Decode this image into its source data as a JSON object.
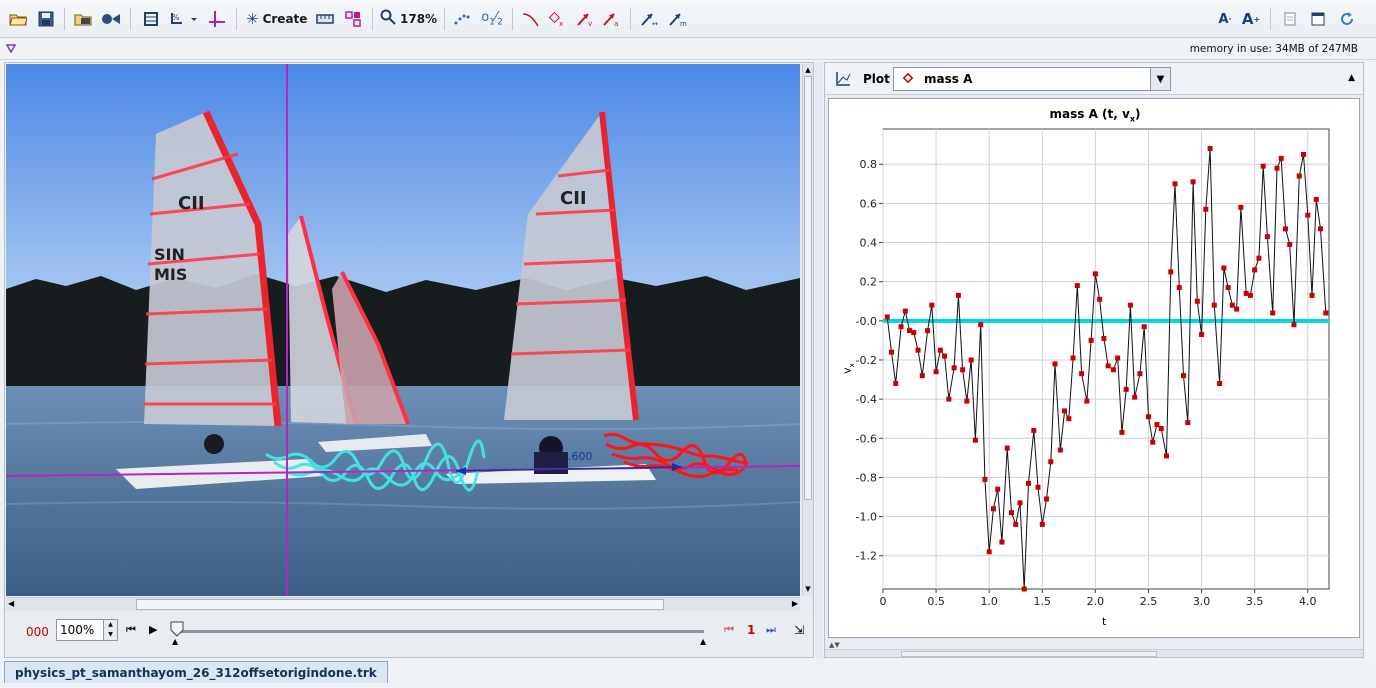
{
  "toolbar": {
    "create_label": "Create",
    "zoom_label": "178%"
  },
  "status": {
    "memory_text": "memory in use: 34MB of 247MB"
  },
  "video": {
    "calibration_label": ".600"
  },
  "player": {
    "frame_number": "000",
    "rate_value": "100%",
    "step_size": "1"
  },
  "plot": {
    "plot_label": "Plot",
    "selected_track": "mass A",
    "title": "mass A (t, v",
    "title_sub": "x",
    "title_end": ")",
    "xlabel": "t",
    "ylabel": "v",
    "ylabel_sub": "x",
    "track_color": "#c40000",
    "axis_line_color": "#00d5e0"
  },
  "chart_data": {
    "type": "line",
    "title": "mass A (t, vx)",
    "xlabel": "t",
    "ylabel": "vx",
    "xlim": [
      0,
      4.2
    ],
    "ylim": [
      -1.37,
      0.98
    ],
    "xticks": [
      "0",
      "0.5",
      "1.0",
      "1.5",
      "2.0",
      "2.5",
      "3.0",
      "3.5",
      "4.0"
    ],
    "yticks": [
      "0.8",
      "0.6",
      "0.4",
      "0.2",
      "-0.0",
      "-0.2",
      "-0.4",
      "-0.6",
      "-0.8",
      "-1.0",
      "-1.2"
    ],
    "grid": true,
    "series": [
      {
        "marker": "square",
        "color": "#cc0000",
        "x": [
          0.04,
          0.08,
          0.12,
          0.17,
          0.21,
          0.25,
          0.29,
          0.33,
          0.37,
          0.42,
          0.46,
          0.5,
          0.54,
          0.58,
          0.62,
          0.67,
          0.71,
          0.75,
          0.79,
          0.83,
          0.87,
          0.92,
          0.96,
          1.0,
          1.04,
          1.08,
          1.12,
          1.17,
          1.21,
          1.25,
          1.29,
          1.33,
          1.37,
          1.42,
          1.46,
          1.5,
          1.54,
          1.58,
          1.62,
          1.67,
          1.71,
          1.75,
          1.79,
          1.83,
          1.87,
          1.92,
          1.96,
          2.0,
          2.04,
          2.08,
          2.12,
          2.17,
          2.21,
          2.25,
          2.29,
          2.33,
          2.37,
          2.42,
          2.46,
          2.5,
          2.54,
          2.58,
          2.62,
          2.67,
          2.71,
          2.75,
          2.79,
          2.83,
          2.87,
          2.92,
          2.96,
          3.0,
          3.04,
          3.08,
          3.12,
          3.17,
          3.21,
          3.25,
          3.29,
          3.33,
          3.37,
          3.42,
          3.46,
          3.5,
          3.54,
          3.58,
          3.62,
          3.67,
          3.71,
          3.75,
          3.79,
          3.83,
          3.87,
          3.92,
          3.96,
          4.0,
          4.04,
          4.08,
          4.12,
          4.17
        ],
        "y": [
          0.02,
          -0.16,
          -0.32,
          -0.03,
          0.05,
          -0.05,
          -0.06,
          -0.15,
          -0.28,
          -0.05,
          0.08,
          -0.26,
          -0.15,
          -0.18,
          -0.4,
          -0.24,
          0.13,
          -0.25,
          -0.41,
          -0.2,
          -0.61,
          -0.02,
          -0.81,
          -1.18,
          -0.96,
          -0.86,
          -1.13,
          -0.65,
          -0.98,
          -1.04,
          -0.93,
          -1.37,
          -0.83,
          -0.56,
          -0.85,
          -1.04,
          -0.91,
          -0.72,
          -0.22,
          -0.66,
          -0.46,
          -0.5,
          -0.19,
          0.18,
          -0.27,
          -0.41,
          -0.1,
          0.24,
          0.11,
          -0.09,
          -0.23,
          -0.25,
          -0.19,
          -0.57,
          -0.35,
          0.08,
          -0.39,
          -0.27,
          -0.03,
          -0.49,
          -0.62,
          -0.53,
          -0.55,
          -0.69,
          0.25,
          0.7,
          0.17,
          -0.28,
          -0.52,
          0.71,
          0.1,
          -0.07,
          0.57,
          0.88,
          0.08,
          -0.32,
          0.27,
          0.17,
          0.08,
          0.06,
          0.58,
          0.14,
          0.13,
          0.26,
          0.32,
          0.79,
          0.43,
          0.04,
          0.78,
          0.83,
          0.47,
          0.39,
          -0.02,
          0.74,
          0.85,
          0.54,
          0.13,
          0.62,
          0.47,
          0.04
        ]
      }
    ]
  }
}
